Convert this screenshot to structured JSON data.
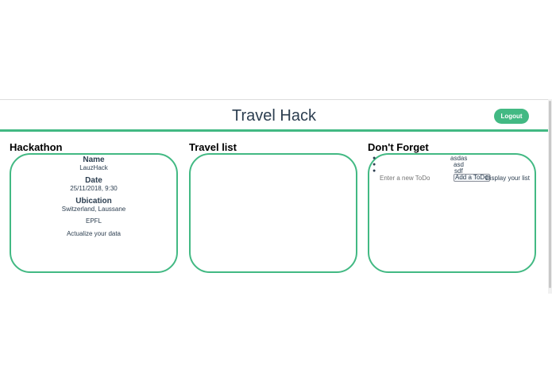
{
  "header": {
    "title": "Travel Hack",
    "logout_label": "Logout"
  },
  "hackathon": {
    "section_title": "Hackathon",
    "name_label": "Name",
    "name_value": "LauzHack",
    "date_label": "Date",
    "date_value": "25/11/2018, 9:30",
    "ubication_label": "Ubication",
    "ubication_value": "Switzerland, Laussane",
    "venue": "EPFL",
    "actualize_label": "Actualize your data"
  },
  "travel_list": {
    "section_title": "Travel list"
  },
  "dont_forget": {
    "section_title": "Don't Forget",
    "items": [
      "asdas",
      "asd",
      "sdf"
    ],
    "input_placeholder": "Enter a new ToDo",
    "input_value": "",
    "add_label": "Add a ToDo",
    "display_label": "Display your list"
  },
  "colors": {
    "accent": "#42b983",
    "text": "#2c3e50"
  }
}
